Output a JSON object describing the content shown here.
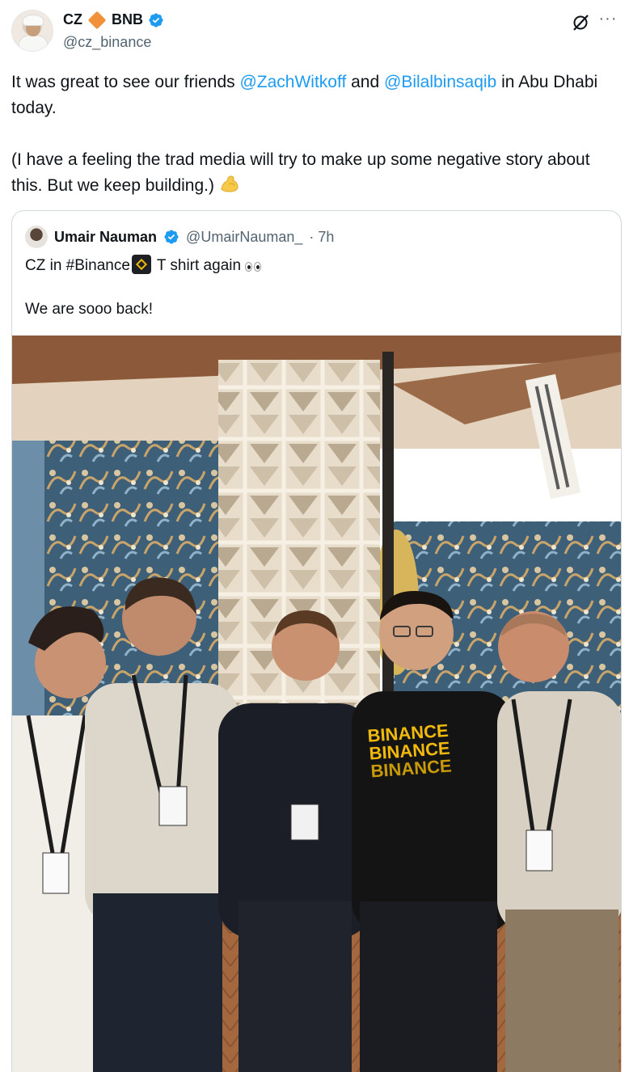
{
  "author": {
    "name": "CZ",
    "name_suffix": "BNB",
    "handle": "@cz_binance"
  },
  "tweet": {
    "line1_pre": "It was great to see our friends ",
    "mention1": "@ZachWitkoff",
    "line1_mid": " and ",
    "mention2": "@Bilalbinsaqib",
    "line1_post": " in Abu Dhabi today.",
    "line2": "(I have a feeling the trad media will try to make up some negative story about this. But we keep building.)"
  },
  "quote": {
    "name": "Umair Nauman",
    "handle": "@UmairNauman_",
    "time": "· 7h",
    "line1_pre": "CZ in #Binance",
    "line1_post": " T shirt again",
    "line2": "We are sooo back!",
    "photo": {
      "shirt_text": [
        "BINANCE",
        "BINANCE",
        "BINANCE"
      ]
    }
  },
  "colors": {
    "accent": "#1d9bf0",
    "muted": "#536471",
    "bnb_orange": "#f0913a",
    "binance_yellow": "#f0b90b"
  },
  "icons": [
    "verified-badge-icon",
    "grok-icon",
    "more-icon",
    "flexed-bicep-icon",
    "binance-logo-icon",
    "eyes-icon"
  ]
}
